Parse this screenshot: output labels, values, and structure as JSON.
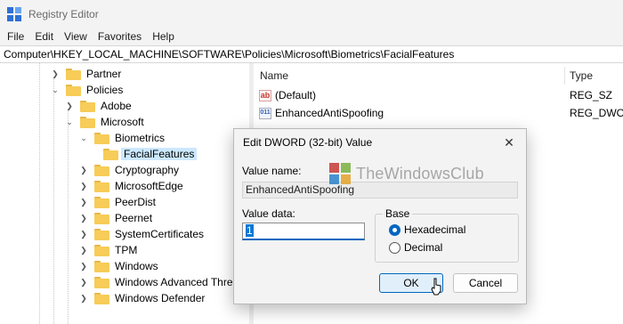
{
  "window": {
    "title": "Registry Editor"
  },
  "menu": [
    "File",
    "Edit",
    "View",
    "Favorites",
    "Help"
  ],
  "address": "Computer\\HKEY_LOCAL_MACHINE\\SOFTWARE\\Policies\\Microsoft\\Biometrics\\FacialFeatures",
  "tree": [
    {
      "label": "Partner",
      "expander": "collapsed",
      "selected": false
    },
    {
      "label": "Policies",
      "expander": "expanded",
      "selected": false
    },
    {
      "label": "Adobe",
      "expander": "collapsed",
      "selected": false
    },
    {
      "label": "Microsoft",
      "expander": "expanded",
      "selected": false
    },
    {
      "label": "Biometrics",
      "expander": "expanded",
      "selected": false
    },
    {
      "label": "FacialFeatures",
      "expander": "none",
      "selected": true
    },
    {
      "label": "Cryptography",
      "expander": "collapsed",
      "selected": false
    },
    {
      "label": "MicrosoftEdge",
      "expander": "collapsed",
      "selected": false
    },
    {
      "label": "PeerDist",
      "expander": "collapsed",
      "selected": false
    },
    {
      "label": "Peernet",
      "expander": "collapsed",
      "selected": false
    },
    {
      "label": "SystemCertificates",
      "expander": "collapsed",
      "selected": false
    },
    {
      "label": "TPM",
      "expander": "collapsed",
      "selected": false
    },
    {
      "label": "Windows",
      "expander": "collapsed",
      "selected": false
    },
    {
      "label": "Windows Advanced Threa",
      "expander": "collapsed",
      "selected": false
    },
    {
      "label": "Windows Defender",
      "expander": "collapsed",
      "selected": false
    }
  ],
  "list": {
    "columns": {
      "name": "Name",
      "type": "Type"
    },
    "rows": [
      {
        "icon": "string-value-icon",
        "glyph": "ab",
        "name": "(Default)",
        "type": "REG_SZ"
      },
      {
        "icon": "dword-value-icon",
        "glyph": "011",
        "name": "EnhancedAntiSpoofing",
        "type": "REG_DWOR"
      }
    ]
  },
  "dialog": {
    "title": "Edit DWORD (32-bit) Value",
    "close_glyph": "✕",
    "value_name_label": "Value name:",
    "value_name": "EnhancedAntiSpoofing",
    "value_data_label": "Value data:",
    "value_data": "1",
    "base_label": "Base",
    "base_options": [
      {
        "label": "Hexadecimal",
        "selected": true
      },
      {
        "label": "Decimal",
        "selected": false
      }
    ],
    "ok_label": "OK",
    "cancel_label": "Cancel"
  },
  "watermark": "TheWindowsClub",
  "colors": {
    "accent": "#0067c0",
    "selection": "#cce8ff",
    "folder": "#f7cc58"
  }
}
